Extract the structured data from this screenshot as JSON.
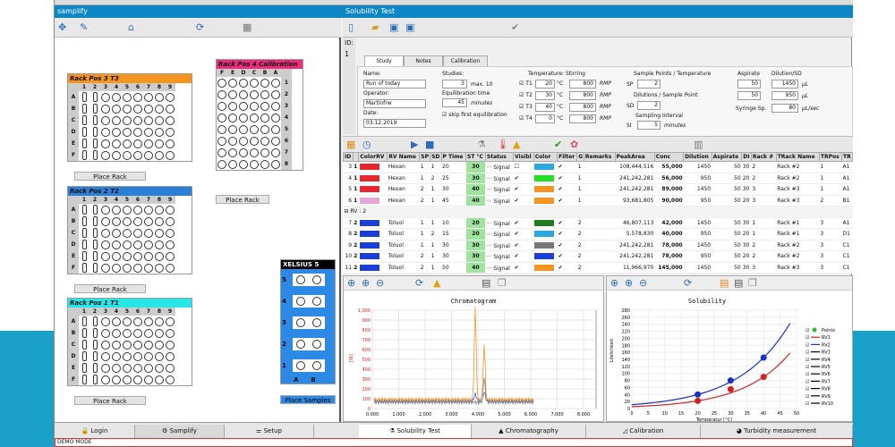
{
  "left_title": "samplify",
  "right_title": "Solubility Test",
  "racks": [
    {
      "label": "Rack Pos 3 T3",
      "color": "#f7941d",
      "place": "Place Rack"
    },
    {
      "label": "Rack Pos 2 T2",
      "color": "#2c7fd6",
      "place": "Place Rack"
    },
    {
      "label": "Rack Pos 1 T1",
      "color": "#29e6e6",
      "place": "Place Rack"
    },
    {
      "label": "Rack Pos 4 Calibration",
      "color": "#ee2a7b",
      "place": "Place Rack"
    }
  ],
  "rack_cols": [
    "1",
    "2",
    "3",
    "4",
    "5",
    "6",
    "7",
    "8",
    "9"
  ],
  "rack_rows": [
    "A",
    "B",
    "C",
    "D",
    "E",
    "F"
  ],
  "calib_cols": [
    "F",
    "E",
    "D",
    "C",
    "B",
    "A"
  ],
  "calib_rows": [
    "1",
    "2",
    "3",
    "4",
    "5",
    "6",
    "7",
    "8"
  ],
  "xelsius": {
    "label": "XELSIUS 5",
    "rows": [
      "5",
      "4",
      "3",
      "2",
      "1"
    ],
    "cols": [
      "A",
      "B"
    ],
    "place": "Place Samples"
  },
  "tabs": [
    "Study",
    "Notes",
    "Calibration"
  ],
  "study": {
    "id_label": "ID:",
    "id": "1",
    "name_label": "Name:",
    "name": "Run of today",
    "operator_label": "Operator:",
    "operator": "Martinfrw",
    "date_label": "Date:",
    "date": "03.12.2019",
    "studies_label": "Studies:",
    "studies": "3",
    "max": "max. 10",
    "eq_label": "Equilibration time",
    "eq": "45",
    "eq_unit": "minutes",
    "skip": "skip first equilibration"
  },
  "temps": {
    "label": "Temperature:",
    "stir_label": "Stirring",
    "rows": [
      {
        "t": "T1",
        "temp": "20",
        "stir": "800"
      },
      {
        "t": "T2",
        "temp": "30",
        "stir": "800"
      },
      {
        "t": "T3",
        "temp": "40",
        "stir": "800"
      },
      {
        "t": "T4",
        "temp": "0",
        "stir": "800"
      }
    ],
    "unit": "°C",
    "rmp": "RMP"
  },
  "sampling": {
    "sp_label": "Sample Points / Temperature",
    "sp": "SP",
    "sp_val": "2",
    "dil_label": "Dilutions / Sample Point",
    "sd": "SD",
    "sd_val": "2",
    "int_label": "Sampling Interval",
    "si": "SI",
    "si_val": "5",
    "si_unit": "minutes"
  },
  "aspirate": {
    "label": "Aspirate",
    "dil_label": "Dilution/SD",
    "rows": [
      [
        "50",
        "1450"
      ],
      [
        "50",
        "950"
      ]
    ],
    "unit": "µL",
    "syr_label": "Syringe Sp.",
    "syr": "80",
    "syr_unit": "µL/sec"
  },
  "grid": {
    "headers": [
      "ID",
      "",
      "ColorRV",
      "RV Name",
      "SP",
      "SD",
      "P Time",
      "ST °C",
      "Status",
      "Visibl",
      "Color",
      "Filter",
      "G",
      "Remarks",
      "PeakArea",
      "Conc",
      "Dilution",
      "Aspirate",
      "DI",
      "Rack #",
      "TRack Name",
      "TRPos",
      "TR"
    ],
    "group1": [
      {
        "id": "3",
        "rv": "1",
        "c": "#e8262d",
        "name": "Hexan",
        "sp": "1",
        "sd": "1",
        "pt": "20",
        "st": "30",
        "status": "Signal",
        "vis": "",
        "col": "#2aa8e0",
        "g": "1",
        "area": "108,444,516",
        "conc": "55,000",
        "dil": "1450",
        "asp": "50",
        "di": "30",
        "rack": "2",
        "trn": "Rack #2",
        "trp": "1",
        "tr": "A1"
      },
      {
        "id": "4",
        "rv": "1",
        "c": "#e8262d",
        "name": "Hexan",
        "sp": "1",
        "sd": "2",
        "pt": "25",
        "st": "30",
        "status": "Signal",
        "vis": "✔",
        "col": "#22e022",
        "g": "1",
        "area": "241,242,281",
        "conc": "56,000",
        "dil": "950",
        "asp": "50",
        "di": "20",
        "rack": "2",
        "trn": "Rack #2",
        "trp": "1",
        "tr": "A1"
      },
      {
        "id": "5",
        "rv": "1",
        "c": "#e8262d",
        "name": "Hexan",
        "sp": "2",
        "sd": "1",
        "pt": "30",
        "st": "40",
        "status": "Signal",
        "vis": "✔",
        "col": "#f7941d",
        "g": "1",
        "area": "241,242,281",
        "conc": "89,000",
        "dil": "1450",
        "asp": "50",
        "di": "30",
        "rack": "3",
        "trn": "Rack #3",
        "trp": "1",
        "tr": "A1"
      },
      {
        "id": "6",
        "rv": "1",
        "c": "#e8a6d8",
        "name": "Hexan",
        "sp": "2",
        "sd": "1",
        "pt": "45",
        "st": "40",
        "status": "Signal",
        "vis": "✔",
        "col": "#f7941d",
        "g": "1",
        "area": "93,681,805",
        "conc": "90,000",
        "dil": "950",
        "asp": "50",
        "di": "20",
        "rack": "3",
        "trn": "Rack #3",
        "trp": "2",
        "tr": "B1"
      }
    ],
    "group_label": "RV : 2",
    "group2": [
      {
        "id": "7",
        "rv": "2",
        "c": "#1a3fd6",
        "name": "Toluol",
        "sp": "1",
        "sd": "1",
        "pt": "10",
        "st": "20",
        "status": "Signal",
        "vis": "✔",
        "col": "#1e7d1e",
        "g": "2",
        "area": "46,807,113",
        "conc": "42,000",
        "dil": "1450",
        "asp": "50",
        "di": "30",
        "rack": "1",
        "trn": "Rack #1",
        "trp": "3",
        "tr": "A1"
      },
      {
        "id": "8",
        "rv": "2",
        "c": "#1a3fd6",
        "name": "Toluol",
        "sp": "1",
        "sd": "2",
        "pt": "15",
        "st": "20",
        "status": "Signal",
        "vis": "✔",
        "col": "#2aa8e0",
        "g": "2",
        "area": "5,578,830",
        "conc": "40,000",
        "dil": "950",
        "asp": "50",
        "di": "20",
        "rack": "1",
        "trn": "Rack #1",
        "trp": "3",
        "tr": "D1"
      },
      {
        "id": "9",
        "rv": "2",
        "c": "#1a3fd6",
        "name": "Toluol",
        "sp": "1",
        "sd": "1",
        "pt": "30",
        "st": "30",
        "status": "Signal",
        "vis": "✔",
        "col": "#777777",
        "g": "2",
        "area": "241,242,281",
        "conc": "78,000",
        "dil": "1450",
        "asp": "50",
        "di": "30",
        "rack": "2",
        "trn": "Rack #2",
        "trp": "3",
        "tr": "C1"
      },
      {
        "id": "10",
        "rv": "2",
        "c": "#1a3fd6",
        "name": "Toluol",
        "sp": "2",
        "sd": "1",
        "pt": "30",
        "st": "30",
        "status": "Signal",
        "vis": "✔",
        "col": "#1a3fd6",
        "g": "2",
        "area": "241,242,281",
        "conc": "78,000",
        "dil": "950",
        "asp": "50",
        "di": "20",
        "rack": "2",
        "trn": "Rack #2",
        "trp": "3",
        "tr": "C1"
      },
      {
        "id": "11",
        "rv": "2",
        "c": "#1a3fd6",
        "name": "Toluol",
        "sp": "2",
        "sd": "1",
        "pt": "50",
        "st": "40",
        "status": "Signal",
        "vis": "✔",
        "col": "#f7941d",
        "g": "2",
        "area": "11,966,970",
        "conc": "145,000",
        "dil": "1450",
        "asp": "50",
        "di": "30",
        "rack": "3",
        "trn": "Rack #3",
        "trp": "3",
        "tr": "C1"
      }
    ]
  },
  "chromatogram": {
    "title": "Chromatogram",
    "ylabel": "[W]",
    "yticks": [
      "1,000",
      "900",
      "800",
      "700",
      "600",
      "500",
      "400",
      "300",
      "200",
      "100",
      "0"
    ],
    "xticks": [
      "0.000",
      "1.000",
      "2.000",
      "3.000",
      "4.000",
      "5.000",
      "6.000",
      "7.000",
      "8.000"
    ]
  },
  "chart_data": {
    "type": "line",
    "title": "Solubility",
    "xlabel": "Temperatur [°C]",
    "ylabel": "Löslichkeit",
    "xlim": [
      0,
      50
    ],
    "ylim": [
      0,
      280
    ],
    "xticks": [
      "0",
      "5",
      "10",
      "15",
      "20",
      "25",
      "30",
      "35",
      "40",
      "45",
      "50"
    ],
    "yticks": [
      "0",
      "20",
      "40",
      "60",
      "80",
      "100",
      "120",
      "140",
      "160",
      "180",
      "200",
      "220",
      "240",
      "260",
      "280"
    ],
    "series": [
      {
        "name": "RV1",
        "color": "#d62020",
        "points": [
          [
            20,
            22
          ],
          [
            30,
            55
          ],
          [
            40,
            90
          ]
        ]
      },
      {
        "name": "RV2",
        "color": "#1a2fc8",
        "points": [
          [
            20,
            40
          ],
          [
            30,
            80
          ],
          [
            40,
            145
          ]
        ]
      }
    ],
    "legend": [
      "Points",
      "RV1",
      "RV2",
      "RV3",
      "RV4",
      "RV5",
      "RV6",
      "RV7",
      "RV8",
      "RV9",
      "RV10"
    ]
  },
  "bottom_tabs": [
    "Login",
    "Samplify",
    "Setup",
    "Solubility Test",
    "Chromatography",
    "Calibration",
    "Turbidity measurement"
  ],
  "status": "DEMO MODE"
}
